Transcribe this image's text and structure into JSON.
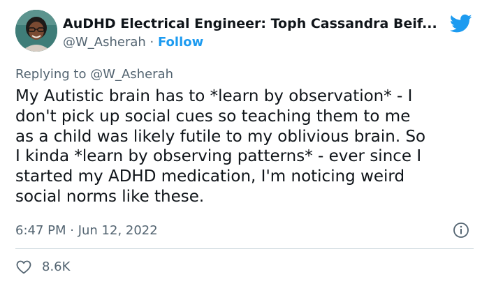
{
  "author": {
    "display_name": "AuDHD Electrical Engineer: Toph Cassandra Beif...",
    "handle": "@W_Asherah",
    "separator": " · ",
    "follow_label": "Follow"
  },
  "reply": {
    "replying_to": "Replying to @W_Asherah"
  },
  "tweet": {
    "lines": [
      "My Autistic brain has to *learn by observation* - I",
      "don't pick up social cues so teaching them to me",
      "as a child was likely futile to my oblivious brain. So",
      "I kinda *learn by observing patterns* - ever since I",
      "started my ADHD medication, I'm noticing weird",
      "social norms like these."
    ],
    "timestamp": "6:47 PM · Jun 12, 2022"
  },
  "engagement": {
    "likes": "8.6K"
  },
  "icons": {
    "brand": "twitter-bird-icon",
    "info": "info-icon",
    "like": "heart-icon"
  },
  "colors": {
    "brand_blue": "#1d9bf0",
    "text_primary": "#0f1419",
    "text_secondary": "#536471",
    "divider": "#cfd9de"
  }
}
